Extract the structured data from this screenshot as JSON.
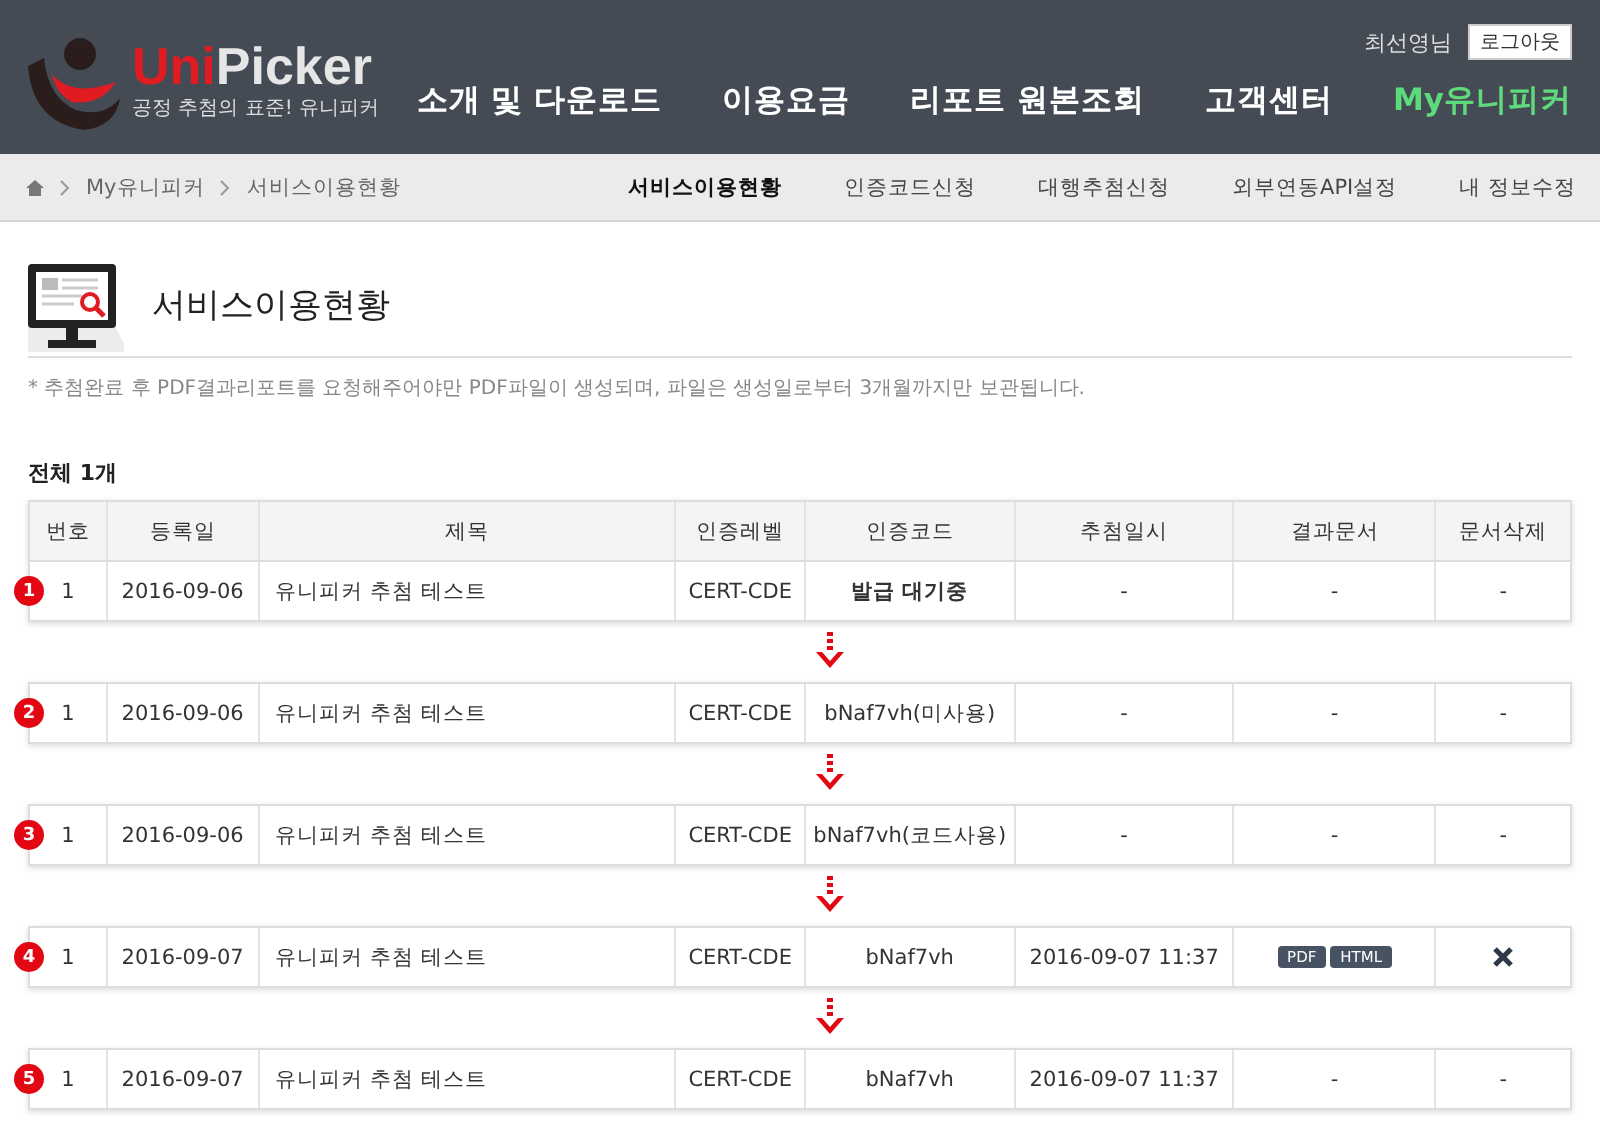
{
  "header": {
    "logo": {
      "brand_part1": "Uni",
      "brand_part2": "Picker",
      "tagline": "공정 추첨의 표준! 유니피커"
    },
    "user": "최선영님",
    "logout": "로그아웃",
    "nav": [
      {
        "label": "소개 및 다운로드",
        "selected": false
      },
      {
        "label": "이용요금",
        "selected": false
      },
      {
        "label": "리포트 원본조회",
        "selected": false
      },
      {
        "label": "고객센터",
        "selected": false
      },
      {
        "label": "My유니피커",
        "selected": true
      }
    ]
  },
  "breadcrumb": [
    "My유니피커",
    "서비스이용현황"
  ],
  "subnav": [
    {
      "label": "서비스이용현황",
      "selected": true
    },
    {
      "label": "인증코드신청",
      "selected": false
    },
    {
      "label": "대행추첨신청",
      "selected": false
    },
    {
      "label": "외부연동API설정",
      "selected": false
    },
    {
      "label": "내 정보수정",
      "selected": false
    }
  ],
  "page_title": "서비스이용현황",
  "note": "* 추첨완료 후 PDF결과리포트를 요청해주어야만 PDF파일이 생성되며, 파일은 생성일로부터 3개월까지만 보관됩니다.",
  "total": "전체 1개",
  "table": {
    "columns": [
      "번호",
      "등록일",
      "제목",
      "인증레벨",
      "인증코드",
      "추첨일시",
      "결과문서",
      "문서삭제"
    ],
    "rows": [
      {
        "step": "1",
        "no": "1",
        "date": "2016-09-06",
        "title": "유니피커 추첨 테스트",
        "level": "CERT-CDE",
        "code": "발급 대기중",
        "code_bold": true,
        "drawn": "-",
        "result": {
          "kind": "text",
          "text": "-"
        },
        "delete": {
          "kind": "text",
          "text": "-"
        }
      },
      {
        "step": "2",
        "no": "1",
        "date": "2016-09-06",
        "title": "유니피커 추첨 테스트",
        "level": "CERT-CDE",
        "code": "bNaf7vh(미사용)",
        "code_bold": false,
        "drawn": "-",
        "result": {
          "kind": "text",
          "text": "-"
        },
        "delete": {
          "kind": "text",
          "text": "-"
        }
      },
      {
        "step": "3",
        "no": "1",
        "date": "2016-09-06",
        "title": "유니피커 추첨 테스트",
        "level": "CERT-CDE",
        "code": "bNaf7vh(코드사용)",
        "code_bold": false,
        "drawn": "-",
        "result": {
          "kind": "text",
          "text": "-"
        },
        "delete": {
          "kind": "text",
          "text": "-"
        }
      },
      {
        "step": "4",
        "no": "1",
        "date": "2016-09-07",
        "title": "유니피커 추첨 테스트",
        "level": "CERT-CDE",
        "code": "bNaf7vh",
        "code_bold": false,
        "drawn": "2016-09-07 11:37",
        "result": {
          "kind": "buttons",
          "buttons": [
            "PDF",
            "HTML"
          ]
        },
        "delete": {
          "kind": "icon"
        }
      },
      {
        "step": "5",
        "no": "1",
        "date": "2016-09-07",
        "title": "유니피커 추첨 테스트",
        "level": "CERT-CDE",
        "code": "bNaf7vh",
        "code_bold": false,
        "drawn": "2016-09-07 11:37",
        "result": {
          "kind": "text",
          "text": "-"
        },
        "delete": {
          "kind": "text",
          "text": "-"
        }
      }
    ]
  }
}
